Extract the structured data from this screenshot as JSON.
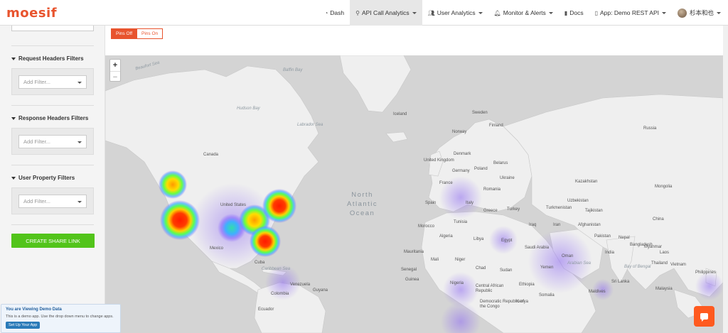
{
  "app": {
    "logo": "moesif"
  },
  "nav": {
    "items": [
      {
        "label": "Dash",
        "icon": "dashboard-icon",
        "caret": false,
        "active": false
      },
      {
        "label": "API Call Analytics",
        "icon": "search-icon",
        "caret": true,
        "active": true
      },
      {
        "label": "User Analytics",
        "icon": "users-icon",
        "caret": true,
        "active": false
      },
      {
        "label": "Monitor & Alerts",
        "icon": "bell-icon",
        "caret": true,
        "active": false
      },
      {
        "label": "Docs",
        "icon": "book-icon",
        "caret": false,
        "active": false
      },
      {
        "label": "App: Demo REST API",
        "icon": "tablet-icon",
        "caret": true,
        "active": false
      },
      {
        "label": "杉本和也",
        "icon": "avatar",
        "caret": true,
        "active": false
      }
    ]
  },
  "sidebar": {
    "sections": [
      {
        "title": "Request Headers Filters",
        "placeholder": "Add Filter..."
      },
      {
        "title": "Response Headers Filters",
        "placeholder": "Add Filter..."
      },
      {
        "title": "User Property Filters",
        "placeholder": "Add Filter..."
      }
    ],
    "share_button": "CREATE SHARE LINK"
  },
  "demo": {
    "title": "You are Viewing Demo Data",
    "text": "This is a demo app. Use the drop down menu to change apps.",
    "button": "Set Up Your App"
  },
  "pins": {
    "off_label": "Pins Off",
    "on_label": "Pins On",
    "selected": "off"
  },
  "map": {
    "zoom_in": "+",
    "zoom_out": "−",
    "ocean": [
      "North",
      "Atlantic",
      "Ocean"
    ],
    "labels": {
      "canada": "Canada",
      "us": "United States",
      "mexico": "Mexico",
      "iceland": "Iceland",
      "sweden": "Sweden",
      "norway": "Norway",
      "finland": "Finland",
      "denmark": "Denmark",
      "uk": "United Kingdom",
      "germany": "Germany",
      "poland": "Poland",
      "belarus": "Belarus",
      "france": "France",
      "ukraine": "Ukraine",
      "romania": "Romania",
      "spain": "Spain",
      "italy": "Italy",
      "greece": "Greece",
      "turkey": "Turkey",
      "russia": "Russia",
      "kazakhstan": "Kazakhstan",
      "mongolia": "Mongolia",
      "china": "China",
      "uzbekistan": "Uzbekistan",
      "turkmenistan": "Turkmenistan",
      "tajikistan": "Tajikistan",
      "afghanistan": "Afghanistan",
      "pakistan": "Pakistan",
      "iran": "Iran",
      "iraq": "Iraq",
      "nepal": "Nepal",
      "india": "India",
      "bangladesh": "Bangladesh",
      "myanmar": "Myanmar",
      "laos": "Laos",
      "thailand": "Thailand",
      "vietnam": "Vietnam",
      "philippines": "Philippines",
      "malaysia": "Malaysia",
      "srilanka": "Sri Lanka",
      "maldives": "Maldives",
      "morocco": "Morocco",
      "tunisia": "Tunisia",
      "algeria": "Algeria",
      "libya": "Libya",
      "egypt": "Egypt",
      "saudi": "Saudi Arabia",
      "oman": "Oman",
      "yemen": "Yemen",
      "mauritania": "Mauritania",
      "mali": "Mali",
      "niger": "Niger",
      "chad": "Chad",
      "sudan": "Sudan",
      "ethiopia": "Ethiopia",
      "somalia": "Somalia",
      "kenya": "Kenya",
      "nigeria": "Nigeria",
      "senegal": "Senegal",
      "guinea": "Guinea",
      "car": "Central African Republic",
      "drc": "Democratic Republic of the Congo",
      "colombia": "Colombia",
      "venezuela": "Venezuela",
      "guyana": "Guyana",
      "ecuador": "Ecuador",
      "cuba": "Cuba"
    },
    "seas": {
      "beaufort": "Beaufort Sea",
      "hudson": "Hudson Bay",
      "baffin": "Baffin Bay",
      "labrador": "Labrador Sea",
      "caribbean": "Caribbean Sea",
      "arabian": "Arabian Sea",
      "bengal": "Bay of Bengal"
    }
  },
  "colors": {
    "brand": "#e8542e",
    "share": "#52c41a",
    "map_land": "#eeeeee",
    "map_water": "#d4d4d4"
  }
}
